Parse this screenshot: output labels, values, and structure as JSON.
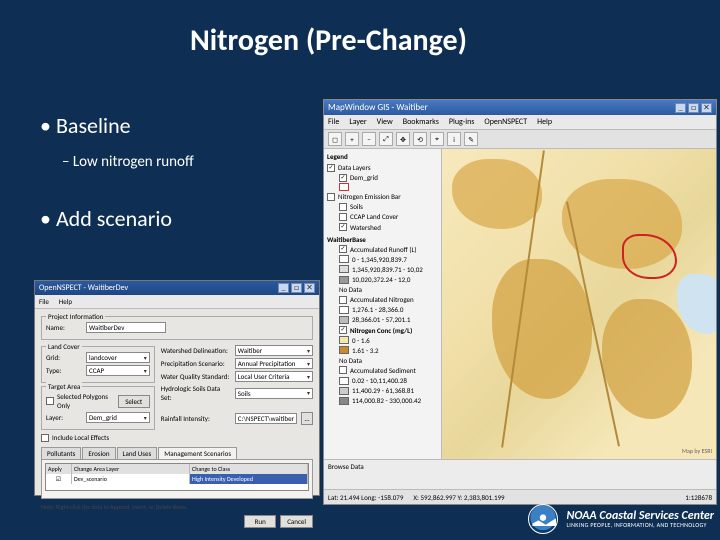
{
  "title": "Nitrogen (Pre-Change)",
  "bullets": {
    "b1": "Baseline",
    "sub": "Low nitrogen runoff",
    "b2": "Add scenario"
  },
  "mapwin": {
    "title": "MapWindow GIS - Waitiber",
    "menu": {
      "m0": "File",
      "m1": "Layer",
      "m2": "View",
      "m3": "Bookmarks",
      "m4": "Plug-ins",
      "m5": "OpenNSPECT",
      "m6": "Help"
    },
    "tool": {
      "t0": "◻",
      "t1": "+",
      "t2": "−",
      "t3": "⤢",
      "t4": "✥",
      "t5": "⟲",
      "t6": "⌖",
      "t7": "i",
      "t8": "✎"
    },
    "legend": {
      "head": "Legend",
      "g_layers": "Data Layers",
      "dem_grid": "Dem_grid",
      "g_nspect": "Nitrogen Emission Bar",
      "soils": "Soils",
      "ccap": "CCAP Land Cover",
      "watershed": "Watershed",
      "ws_name": "WaitiberBase",
      "ws_r1": "Accumulated Runoff (L)",
      "ws_v1a": "0 - 1,345,920,839.7",
      "ws_v1b": "1,345,920,839.71 - 10,02",
      "ws_v1c": "10,020,372.24 - 12,0",
      "no_data1": "No Data",
      "accn": "Accumulated Nitrogen",
      "an_v1": "1,276.1 - 28,366.0",
      "an_v2": "28,366.01 - 57,201.1",
      "nc_head": "Nitrogen Conc (mg/L)",
      "nc_v1": "0 - 1.6",
      "nc_v2": "1.61 - 3.2",
      "nc_v3": "No Data",
      "as_head": "Accumulated Sediment",
      "as_v1": "0.02 - 10,11,400.28",
      "as_v2": "11,400.29 - 61,368.81",
      "as_v3": "114,000.82 - 330,000.42"
    },
    "browse": "Browse Data",
    "status": {
      "lat": "Lat: 21.494 Long: -158.079",
      "xy": "X: 592,862.997 Y: 2,383,801.199",
      "count": "1:128678"
    },
    "credit": "Map by ESRI"
  },
  "dialog": {
    "title": "OpenNSPECT - WaitiberDev",
    "menu": {
      "m0": "File",
      "m1": "Help"
    },
    "f_project": "Project Information",
    "name_lbl": "Name:",
    "name_val": "WaitiberDev",
    "f_landcover": "Land Cover",
    "grid_lbl": "Grid:",
    "grid_val": "landcover",
    "type_lbl": "Type:",
    "type_val": "CCAP",
    "wd_lbl": "Watershed Delineation:",
    "wd_val": "Waitiber",
    "ps_lbl": "Precipitation Scenario:",
    "ps_val": "Annual Precipitation",
    "wq_lbl": "Water Quality Standard:",
    "wq_val": "Local User Criteria",
    "hs_lbl": "Hydrologic Soils Data Set:",
    "hs_val": "Soils",
    "f_target": "Target Area",
    "spo": "Selected Polygons Only",
    "layer_lbl": "Layer:",
    "layer_val": "Dem_grid",
    "select_btn": "Select",
    "loc_eff": "Include Local Effects",
    "rd_lbl": "Rainfall Intensity:",
    "rd_val": "C:\\NSPECT\\waitiber",
    "rd_btn": "...",
    "tabs": {
      "t0": "Pollutants",
      "t1": "Erosion",
      "t2": "Land Uses",
      "t3": "Management Scenarios"
    },
    "gh": {
      "c0": "Apply",
      "c1": "Change Area Layer",
      "c2": "Change to Class"
    },
    "gr": {
      "c0": "☑",
      "c1": "Dev_scenario",
      "c2": "High Intensity Developed"
    },
    "note": "Note: Right-click the data to Append, Insert, or Delete Rows.",
    "run": "Run",
    "cancel": "Cancel"
  },
  "footer": {
    "l1": "NOAA Coastal Services Center",
    "l2": "LINKING PEOPLE, INFORMATION, AND TECHNOLOGY"
  }
}
